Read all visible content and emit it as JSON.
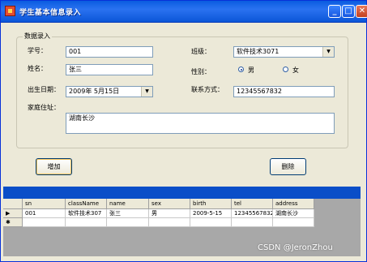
{
  "window": {
    "title": "学生基本信息录入"
  },
  "titlebar_buttons": {
    "minimize": "_",
    "maximize": "□",
    "close": "✕"
  },
  "group": {
    "legend": "数据录入"
  },
  "form": {
    "sn_label": "学号：",
    "sn_value": "001",
    "class_label": "班级：",
    "class_value": "软件技术3071",
    "name_label": "姓名：",
    "name_value": "张三",
    "sex_label": "性别：",
    "sex_male": "男",
    "sex_female": "女",
    "sex_selected": "男",
    "birth_label": "出生日期：",
    "birth_value": "2009年 5月15日",
    "tel_label": "联系方式：",
    "tel_value": "12345567832",
    "address_label": "家庭住址：",
    "address_value": "湖南长沙"
  },
  "buttons": {
    "add": "增加",
    "delete": "删除"
  },
  "grid": {
    "columns": [
      "sn",
      "className",
      "name",
      "sex",
      "birth",
      "tel",
      "address"
    ],
    "rows": [
      {
        "marker": "▶",
        "cells": [
          "001",
          "软件技术307",
          "张三",
          "男",
          "2009-5-15",
          "12345567832",
          "湖南长沙"
        ]
      }
    ],
    "new_row_marker": "✱"
  },
  "watermark": "CSDN @JeronZhou",
  "colors": {
    "title_bar": "#0a5ce0",
    "window_bg": "#ece9d8",
    "grid_bg": "#a8a8a8",
    "grid_header_strip": "#0a4ec8"
  }
}
